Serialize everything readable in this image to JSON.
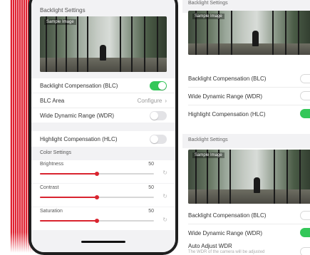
{
  "phone": {
    "backlight_title": "Backlight Settings",
    "image_label": "Sample Image",
    "rows": {
      "blc": {
        "label": "Backlight Compensation (BLC)",
        "on": true
      },
      "blc_area": {
        "label": "BLC Area",
        "value": "Configure"
      },
      "wdr": {
        "label": "Wide Dynamic Range (WDR)",
        "on": false
      },
      "hlc": {
        "label": "Highlight Compensation (HLC)",
        "on": false
      }
    },
    "color_title": "Color Settings",
    "sliders": [
      {
        "label": "Brightness",
        "value": "50",
        "fraction": 0.5
      },
      {
        "label": "Contrast",
        "value": "50",
        "fraction": 0.5
      },
      {
        "label": "Saturation",
        "value": "50",
        "fraction": 0.5
      }
    ],
    "reset_icon": "reset-icon"
  },
  "right_top": {
    "title": "Backlight Settings",
    "image_label": "Sample Image",
    "rows": [
      {
        "label": "Backlight Compensation (BLC)",
        "on": false
      },
      {
        "label": "Wide Dynamic Range (WDR)",
        "on": false
      },
      {
        "label": "Highlight Compensation (HLC)",
        "on": true
      }
    ]
  },
  "right_bottom": {
    "title": "Backlight Settings",
    "image_label": "Sample Image",
    "rows": [
      {
        "label": "Backlight Compensation (BLC)",
        "on": false
      },
      {
        "label": "Wide Dynamic Range (WDR)",
        "on": true
      },
      {
        "label": "Auto Adjust WDR",
        "on": false
      }
    ],
    "auto_sub": "The WDR of the camera will be adjusted"
  },
  "colors": {
    "accent_red": "#d9242f",
    "toggle_green": "#34c759"
  }
}
